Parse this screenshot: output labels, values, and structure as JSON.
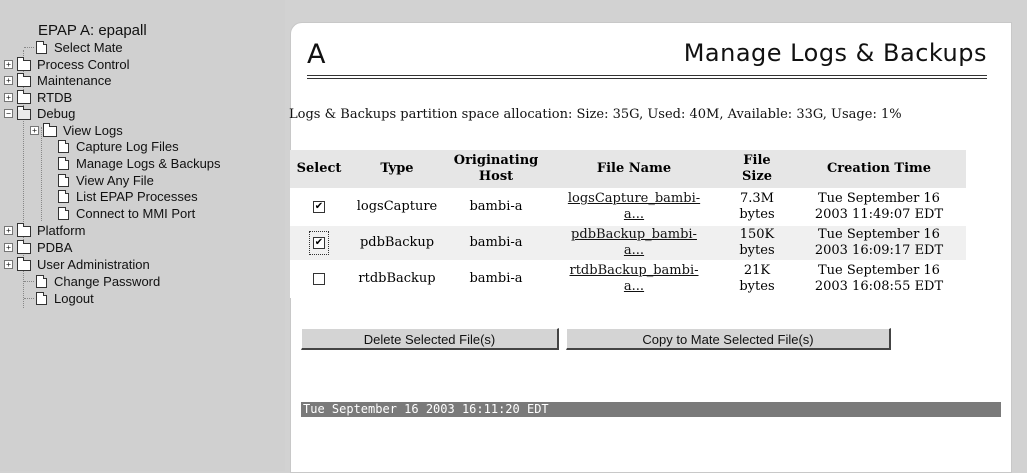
{
  "tree": {
    "title": "EPAP A: epapall",
    "items": [
      {
        "label": "Select Mate"
      },
      {
        "label": "Process Control"
      },
      {
        "label": "Maintenance"
      },
      {
        "label": "RTDB"
      },
      {
        "label": "Debug"
      },
      {
        "label": "View Logs"
      },
      {
        "label": "Capture Log Files"
      },
      {
        "label": "Manage Logs & Backups"
      },
      {
        "label": "View Any File"
      },
      {
        "label": "List EPAP Processes"
      },
      {
        "label": "Connect to MMI Port"
      },
      {
        "label": "Platform"
      },
      {
        "label": "PDBA"
      },
      {
        "label": "User Administration"
      },
      {
        "label": "Change Password"
      },
      {
        "label": "Logout"
      }
    ]
  },
  "panel": {
    "letter": "A",
    "title": "Manage Logs & Backups",
    "allocation_text": "Logs & Backups partition space allocation: Size: 35G, Used: 40M, Available: 33G, Usage: 1%"
  },
  "table": {
    "headers": {
      "select": "Select",
      "type": "Type",
      "host_line1": "Originating",
      "host_line2": "Host",
      "file_name": "File Name",
      "size_line1": "File",
      "size_line2": "Size",
      "created": "Creation Time"
    },
    "rows": [
      {
        "checked": "✔",
        "type": "logsCapture",
        "host": "bambi-a",
        "file_line1": "logsCapture_bambi-",
        "file_line2": "a...",
        "size": "7.3M",
        "size_unit": "bytes",
        "date_line1": "Tue September 16",
        "date_line2": "2003 11:49:07 EDT"
      },
      {
        "checked": "✔",
        "type": "pdbBackup",
        "host": "bambi-a",
        "file_line1": "pdbBackup_bambi-",
        "file_line2": "a...",
        "size": "150K",
        "size_unit": "bytes",
        "date_line1": "Tue September 16",
        "date_line2": "2003 16:09:17 EDT"
      },
      {
        "checked": "",
        "type": "rtdbBackup",
        "host": "bambi-a",
        "file_line1": "rtdbBackup_bambi-",
        "file_line2": "a...",
        "size": "21K",
        "size_unit": "bytes",
        "date_line1": "Tue September 16",
        "date_line2": "2003 16:08:55 EDT"
      }
    ]
  },
  "buttons": {
    "delete": "Delete Selected File(s)",
    "copy": "Copy to Mate Selected File(s)"
  },
  "status": {
    "timestamp": "Tue September 16 2003 16:11:20 EDT"
  },
  "colors": {
    "background": "#d2d2d2",
    "panel": "#ffffff",
    "header_row": "#e6e6e6",
    "status_bar": "#7a7a7a"
  }
}
